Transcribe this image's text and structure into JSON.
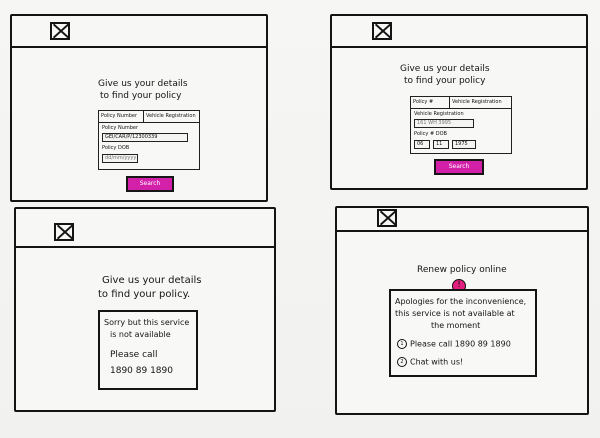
{
  "screens": [
    {
      "heading_line1": "Give us your details",
      "heading_line2": "to find your policy",
      "tabs": [
        "Policy Number",
        "Vehicle Registration"
      ],
      "policy_number_label": "Policy Number",
      "policy_number_value": "GEI/CAR/P/12300339",
      "dob_label": "Policy DOB",
      "dob_value": "dd/mm/yyyy",
      "search_button": "Search"
    },
    {
      "heading_line1": "Give us your details",
      "heading_line2": "to find your policy",
      "tabs": [
        "Policy #",
        "Vehicle Registration"
      ],
      "reg_label": "Vehicle Registration",
      "reg_value": "161 WH 3995",
      "dob_label": "Policy # DOB",
      "dob_values": [
        "06",
        "11",
        "1975"
      ],
      "search_button": "Search"
    },
    {
      "heading_line1": "Give us your details",
      "heading_line2": "to find your policy.",
      "message_line1": "Sorry but this service",
      "message_line2": "is not available",
      "call_label": "Please call",
      "phone": "1890 89 1890"
    },
    {
      "title": "Renew policy online",
      "alert_symbol": "!",
      "message_line1": "Apologies for the inconvenience,",
      "message_line2": "this service is not available at",
      "message_line3": "the moment",
      "option1_num": "1",
      "option1": "Please call   1890 89 1890",
      "option2_num": "2",
      "option2": "Chat with us!"
    }
  ],
  "colors": {
    "accent": "#d320a8",
    "alert": "#e3207f",
    "ink": "#141414",
    "paper": "#f3f3f1"
  },
  "icons": [
    "close-icon",
    "alert-icon"
  ]
}
